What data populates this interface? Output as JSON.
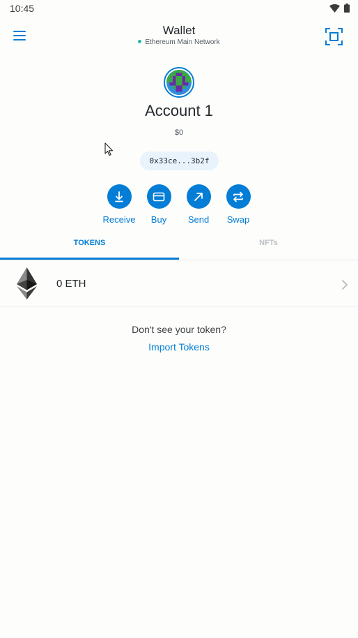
{
  "status_bar": {
    "time": "10:45",
    "icons": [
      "wifi-icon",
      "battery-icon"
    ]
  },
  "header": {
    "title": "Wallet",
    "network": "Ethereum Main Network",
    "network_dot_color": "#29b6af",
    "left_icon": "hamburger-menu-icon",
    "right_icon": "scan-qr-icon"
  },
  "account": {
    "name": "Account 1",
    "balance": "$0",
    "address": "0x33ce...3b2f"
  },
  "actions": [
    {
      "label": "Receive",
      "icon": "receive-arrow-icon"
    },
    {
      "label": "Buy",
      "icon": "card-icon"
    },
    {
      "label": "Send",
      "icon": "send-arrow-icon"
    },
    {
      "label": "Swap",
      "icon": "swap-arrows-icon"
    }
  ],
  "tabs": [
    {
      "label": "TOKENS",
      "active": true
    },
    {
      "label": "NFTs",
      "active": false
    }
  ],
  "tokens": [
    {
      "balance": "0 ETH",
      "icon": "eth-icon"
    }
  ],
  "import": {
    "prompt": "Don't see your token?",
    "link": "Import Tokens"
  },
  "colors": {
    "accent": "#037dd6",
    "background": "#fdfdfb",
    "text": "#24292e",
    "inactive_tab": "#bbc0c5"
  }
}
